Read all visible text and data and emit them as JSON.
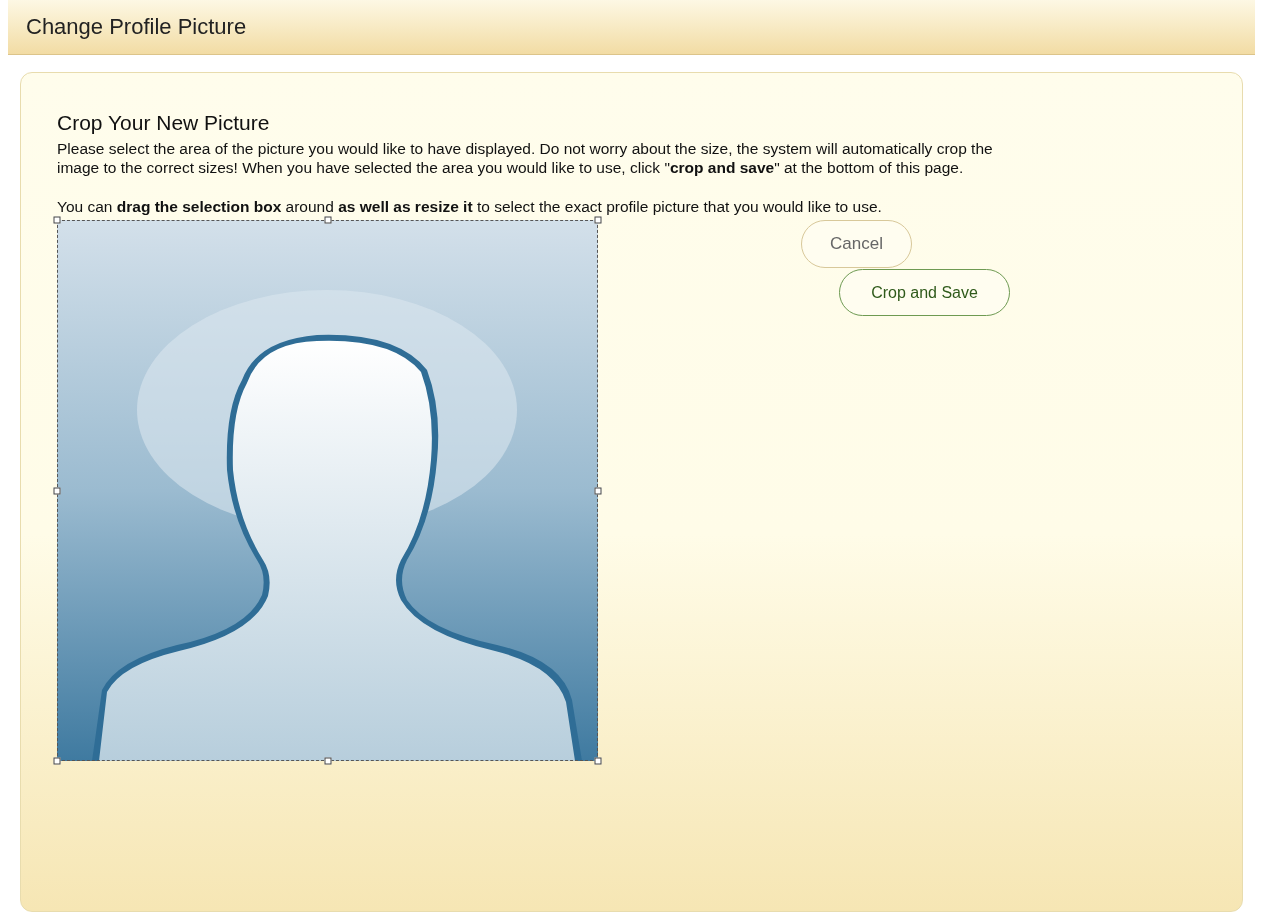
{
  "header": {
    "title": "Change Profile Picture"
  },
  "panel": {
    "title": "Crop Your New Picture",
    "paragraphs": [
      "Please select the area of the picture you would like to have displayed. Do not worry about the size, the system will automatically crop the image to the correct sizes! When you have selected the area you would like to use, click \"**crop and save**\" at the bottom of this page.",
      "You can **drag the selection box** around **as well as resize it** to select the exact profile picture that you would like to use."
    ],
    "buttons": [
      {
        "label": "Cancel",
        "kind": "secondary"
      },
      {
        "label": "Crop and Save",
        "kind": "primary"
      }
    ]
  }
}
